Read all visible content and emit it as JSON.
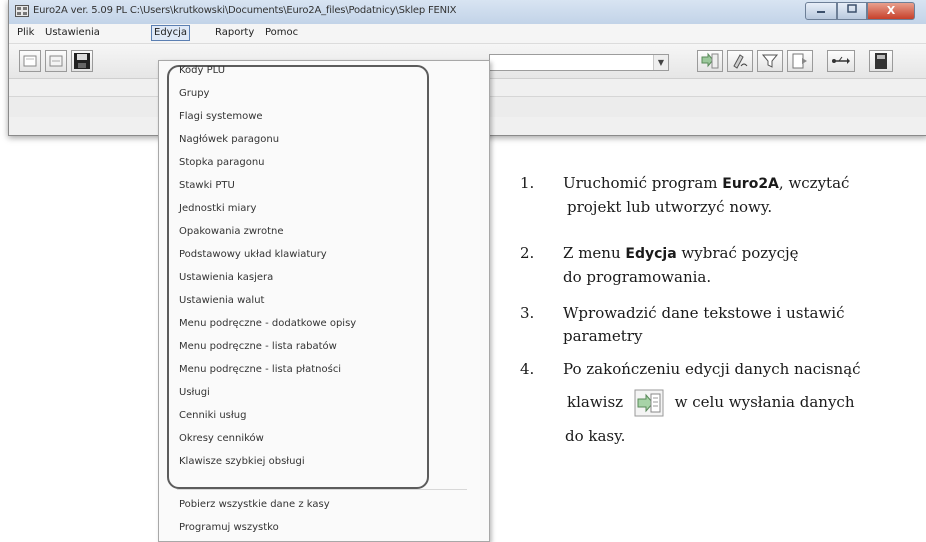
{
  "window": {
    "title": "Euro2A ver. 5.09 PL   C:\\Users\\krutkowski\\Documents\\Euro2A_files\\Podatnicy\\Sklep FENIX",
    "close_label": "X"
  },
  "menubar": {
    "items": [
      "Plik",
      "Ustawienia",
      "Edycja",
      "Raporty",
      "Pomoc"
    ],
    "active": "Edycja"
  },
  "edycja_menu": {
    "items": [
      "Kody PLU",
      "Grupy",
      "Flagi systemowe",
      "Nagłówek paragonu",
      "Stopka paragonu",
      "Stawki PTU",
      "Jednostki miary",
      "Opakowania zwrotne",
      "Podstawowy układ klawiatury",
      "Ustawienia kasjera",
      "Ustawienia walut",
      "Menu podręczne - dodatkowe opisy",
      "Menu podręczne - lista rabatów",
      "Menu podręczne - lista płatności",
      "Usługi",
      "Cenniki usług",
      "Okresy cenników",
      "Klawisze szybkiej obsługi"
    ],
    "extra_items": [
      "Pobierz wszystkie dane z kasy",
      "Programuj wszystko"
    ]
  },
  "instructions": {
    "step1": {
      "num": "1.",
      "pre": "Uruchomić program ",
      "bold": "Euro2A",
      "post": ", wczytać",
      "line2": "projekt lub utworzyć nowy."
    },
    "step2": {
      "num": "2.",
      "pre": "Z menu ",
      "bold": "Edycja",
      "post": "  wybrać pozycję",
      "line2": "do programowania."
    },
    "step3": {
      "num": "3.",
      "line1": "Wprowadzić dane tekstowe i ustawić",
      "line2": "parametry"
    },
    "step4": {
      "num": "4.",
      "line1": "Po zakończeniu edycji danych nacisnąć",
      "pre": "klawisz",
      "post": "w celu wysłania danych",
      "line3": "do kasy."
    }
  },
  "icons": [
    "app-icon",
    "new-file-icon",
    "open-file-icon",
    "save-icon",
    "send-data-icon",
    "signature-icon",
    "filter-icon",
    "document-arrow-icon",
    "usb-icon",
    "book-icon"
  ]
}
